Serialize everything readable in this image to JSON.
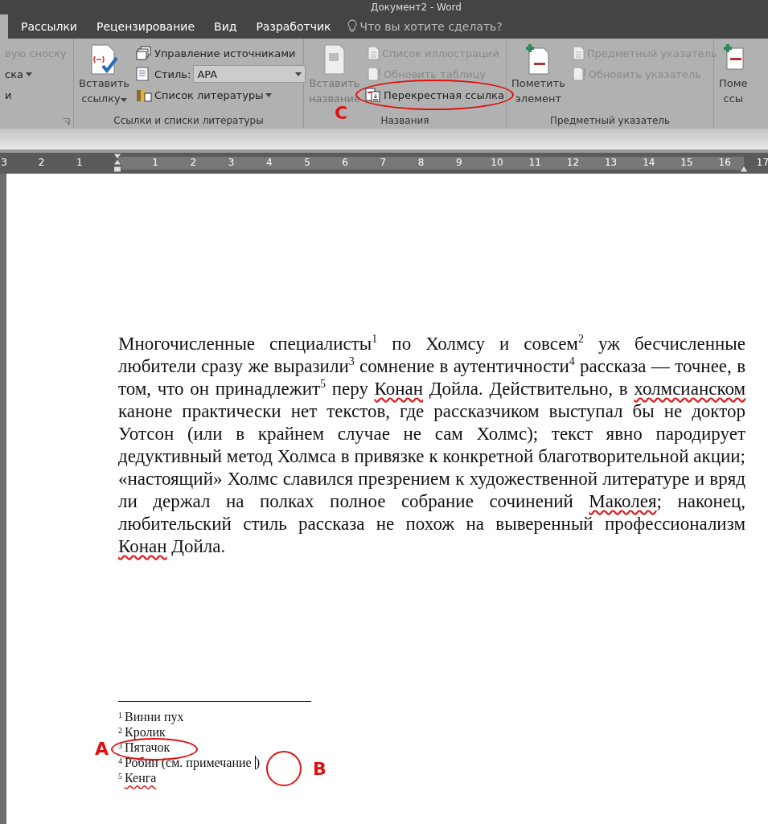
{
  "window": {
    "title": "Документ2 - Word"
  },
  "tabs": [
    {
      "label": "Рассылки",
      "selected": false
    },
    {
      "label": "Рецензирование",
      "selected": false
    },
    {
      "label": "Вид",
      "selected": false
    },
    {
      "label": "Разработчик",
      "selected": false
    }
  ],
  "tell_me": {
    "placeholder": "Что вы хотите сделать?"
  },
  "ribbon": {
    "groups": [
      {
        "small": [
          {
            "label": "вую сноску",
            "disabled": true
          },
          {
            "label": "ска",
            "disabled": false,
            "dropdown": true
          },
          {
            "label": "и",
            "disabled": false
          }
        ],
        "launcher": true
      },
      {
        "label": "Ссылки и списки литературы",
        "big": [
          {
            "lines": [
              "Вставить",
              "ссылку"
            ],
            "disabled": false,
            "dropdown": true
          }
        ],
        "small": [
          {
            "label": "Управление источниками",
            "disabled": false
          },
          {
            "label": "Стиль:",
            "disabled": false,
            "select": "APA"
          },
          {
            "label": "Список литературы",
            "disabled": false,
            "dropdown": true
          }
        ]
      },
      {
        "label": "Названия",
        "big": [
          {
            "lines": [
              "Вставить",
              "название"
            ],
            "disabled": true
          }
        ],
        "small": [
          {
            "label": "Список иллюстраций",
            "disabled": true
          },
          {
            "label": "Обновить таблицу",
            "disabled": true
          },
          {
            "label": "Перекрестная ссылка",
            "disabled": false
          }
        ]
      },
      {
        "label": "Предметный указатель",
        "big": [
          {
            "lines": [
              "Пометить",
              "элемент"
            ],
            "disabled": false
          }
        ],
        "small": [
          {
            "label": "Предметный указатель",
            "disabled": true
          },
          {
            "label": "Обновить указатель",
            "disabled": true
          }
        ]
      },
      {
        "big": [
          {
            "lines": [
              "Поме",
              "ссы"
            ],
            "disabled": false
          }
        ]
      }
    ]
  },
  "ruler": {
    "labels": [
      "3",
      "2",
      "1",
      "1",
      "2",
      "3",
      "4",
      "5",
      "6",
      "7",
      "8",
      "9",
      "10",
      "11",
      "12",
      "13",
      "14",
      "15",
      "16",
      "17"
    ]
  },
  "document": {
    "paragraph": [
      {
        "text": "Многочисленные специалисты$^{1}$ по Холмсу и совсем$^{2}$ уж бесчисленные любители сразу же выразили$^{3}$ сомнение в аутентичности$^{4}$ рассказа — точнее, в том, что он принадлежит$^{5}$ перу ",
        "misspelled": false
      },
      {
        "text": "Конан",
        "misspelled": true
      },
      {
        "text": " Дойла. Действительно, в ",
        "misspelled": false
      },
      {
        "text": "холмсианском",
        "misspelled": true
      },
      {
        "text": " каноне практически нет текстов, где рассказчиком выступал бы не доктор Уотсон (или в крайнем случае не сам Холмс); текст явно пародирует дедуктивный метод Холмса в привязке к конкретной благотворительной акции; «настоящий» Холмс славился презрением к художественной литературе и вряд ли держал на полках полное собрание сочинений ",
        "misspelled": false
      },
      {
        "text": "Маколея",
        "misspelled": true
      },
      {
        "text": "; наконец, любительский стиль рассказа не похож на выверенный профессионализм ",
        "misspelled": false
      },
      {
        "text": "Конан",
        "misspelled": true
      },
      {
        "text": " Дойла.",
        "misspelled": false
      }
    ],
    "footnotes": [
      {
        "mark": "1",
        "text": "Винни пух",
        "misspelled": false
      },
      {
        "mark": "2",
        "text": "Кролик",
        "misspelled": false
      },
      {
        "mark": "3",
        "text": "Пятачок",
        "misspelled": false
      },
      {
        "mark": "4",
        "text": "Робин (см. примечание ",
        "tail": ")",
        "caret": true,
        "misspelled": false
      },
      {
        "mark": "5",
        "text": "Кенга",
        "misspelled": true
      }
    ]
  },
  "annotations": [
    {
      "label": "A"
    },
    {
      "label": "B"
    },
    {
      "label": "C"
    }
  ]
}
